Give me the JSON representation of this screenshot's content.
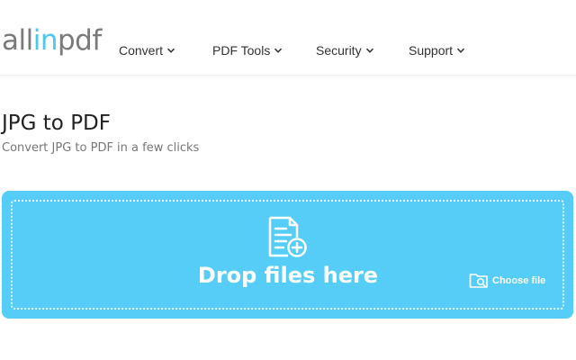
{
  "header": {
    "logo": {
      "part1": "all",
      "part2": "in",
      "part3": "pdf"
    },
    "nav": [
      {
        "label": "Convert"
      },
      {
        "label": "PDF Tools"
      },
      {
        "label": "Security"
      },
      {
        "label": "Support"
      }
    ]
  },
  "main": {
    "title": "JPG to PDF",
    "subtitle": "Convert JPG to PDF in a few clicks"
  },
  "dropzone": {
    "drop_text": "Drop files here",
    "choose_label": "Choose file",
    "icons": [
      "document-add-icon",
      "folder-search-icon"
    ]
  },
  "colors": {
    "brand_gray": "#7a7a7a",
    "brand_blue": "#4dc7f1",
    "dropzone_bg": "#55cdf6"
  }
}
